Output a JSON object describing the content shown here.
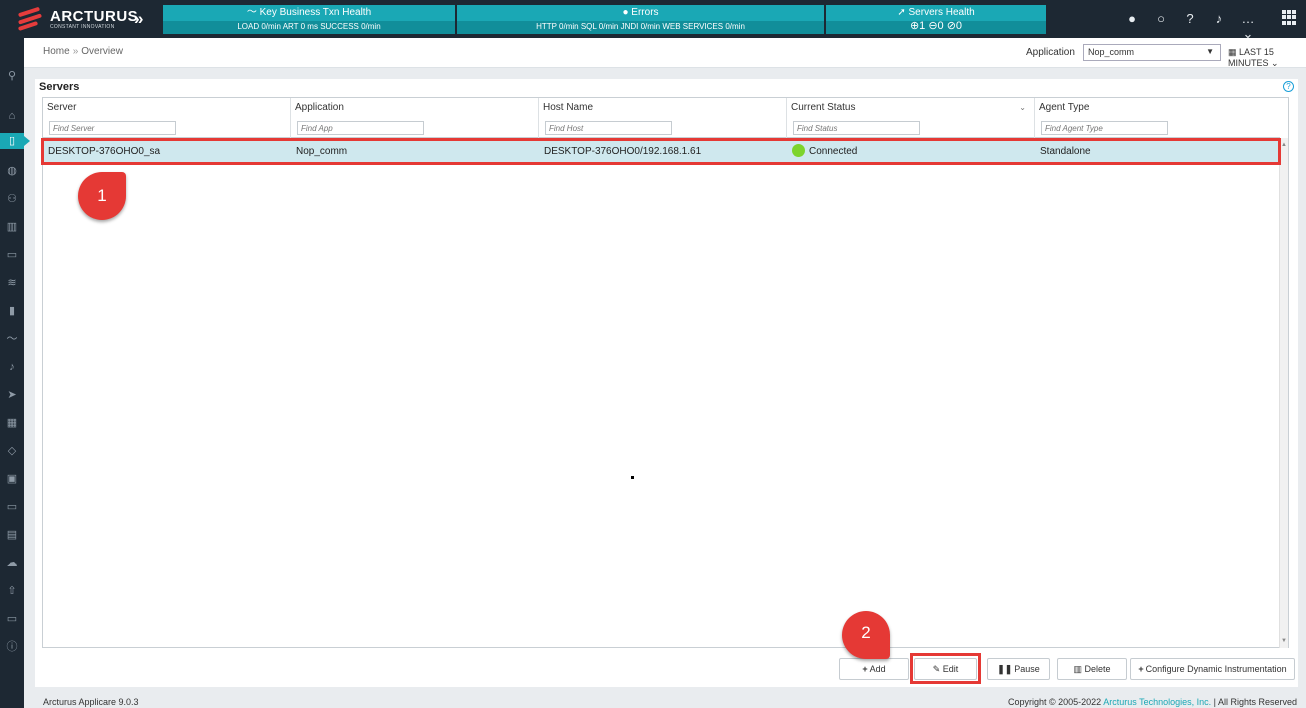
{
  "brand": {
    "name": "ARCTURUS",
    "tagline": "CONSTANT INNOVATION"
  },
  "panels": {
    "business": {
      "title": "Key Business Txn Health",
      "desc": "LOAD 0/min  ART 0 ms  SUCCESS 0/min"
    },
    "errors": {
      "title": "Errors",
      "desc": "HTTP 0/min  SQL 0/min  JNDI 0/min  WEB SERVICES 0/min"
    },
    "servers": {
      "title": "Servers Health",
      "desc": "⊕1  ⊖0  ⊘0"
    }
  },
  "header": {
    "breadcrumb_home": "Home",
    "breadcrumb_sep": "»",
    "breadcrumb_current": "Overview",
    "application_label": "Application",
    "application_value": "Nop_comm",
    "time_range": "LAST 15 MINUTES"
  },
  "section": {
    "title": "Servers"
  },
  "columns": [
    {
      "label": "Server",
      "filter_placeholder": "Find Server"
    },
    {
      "label": "Application",
      "filter_placeholder": "Find App"
    },
    {
      "label": "Host Name",
      "filter_placeholder": "Find Host"
    },
    {
      "label": "Current Status",
      "filter_placeholder": "Find Status"
    },
    {
      "label": "Agent Type",
      "filter_placeholder": "Find Agent Type"
    }
  ],
  "rows": [
    {
      "server": "DESKTOP-376OHO0_sa",
      "application": "Nop_comm",
      "host": "DESKTOP-376OHO0/192.168.1.61",
      "status": "Connected",
      "agent_type": "Standalone"
    }
  ],
  "callouts": {
    "one": "1",
    "two": "2"
  },
  "buttons": {
    "add": "Add",
    "edit": "Edit",
    "pause": "Pause",
    "delete": "Delete",
    "configure": "Configure Dynamic Instrumentation"
  },
  "footer": {
    "version": "Arcturus Applicare 9.0.3",
    "copyright": "Copyright © 2005-2022",
    "company": "Arcturus Technologies, Inc.",
    "rights": "|  All Rights Reserved"
  },
  "colors": {
    "accent": "#1aa8b5",
    "topbar": "#1d2833",
    "callout": "#e53935",
    "connected": "#7dd42c",
    "selected_row": "#cfe8ee"
  }
}
